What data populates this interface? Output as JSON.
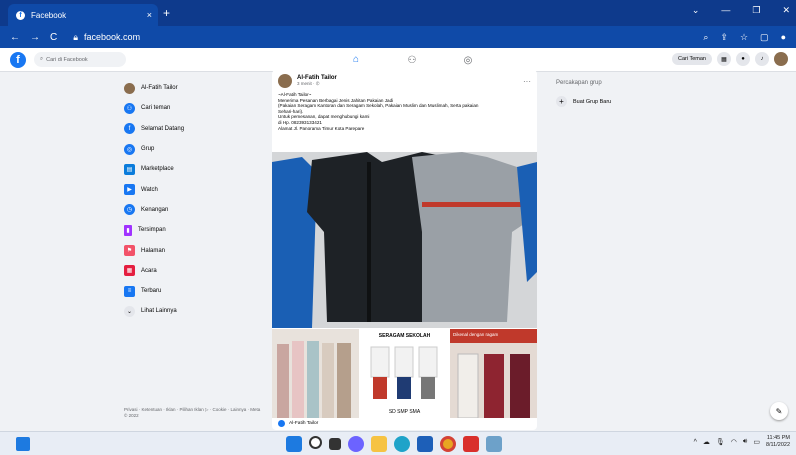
{
  "browser": {
    "tab_title": "Facebook",
    "tab_close": "×",
    "new_tab": "+",
    "url": "facebook.com",
    "min": "—",
    "max": "❐",
    "close": "✕"
  },
  "fb": {
    "search_placeholder": "Cari di Facebook",
    "find_friends_btn": "Cari Teman"
  },
  "sidebar": {
    "items": [
      {
        "label": "Al-Fatih Tailor",
        "color": "#8a6d4e"
      },
      {
        "label": "Cari teman",
        "color": "#1877f2"
      },
      {
        "label": "Selamat Datang",
        "color": "#1877f2"
      },
      {
        "label": "Grup",
        "color": "#1877f2"
      },
      {
        "label": "Marketplace",
        "color": "#0a7cdb"
      },
      {
        "label": "Watch",
        "color": "#1877f2"
      },
      {
        "label": "Kenangan",
        "color": "#1877f2"
      },
      {
        "label": "Tersimpan",
        "color": "#a033ff"
      },
      {
        "label": "Halaman",
        "color": "#f25268"
      },
      {
        "label": "Acara",
        "color": "#e41e3f"
      },
      {
        "label": "Terbaru",
        "color": "#1877f2"
      },
      {
        "label": "Lihat Lainnya",
        "color": "#e4e6eb"
      }
    ],
    "footer": "Privasi · Ketentuan · Iklan · Pilihan Iklan ▷ · Cookie · Lainnya · Meta © 2022"
  },
  "post": {
    "author": "Al-Fatih Tailor",
    "time": "3 menit · ✆",
    "menu": "···",
    "lines": [
      "~Al-Fatih Tailor~",
      "Menerima Pesanan Berbagai Jenis Jahitan Pakaian Jadi",
      "(Pakaian Seragam Kantoran dan Seragam Sekolah, Pakaian Muslim dan Muslimah, Serta pakaian",
      "Sehari-hari).",
      "Untuk pemesanan, dapat menghubungi kami",
      "di Hp. 082393133421",
      "Alamat Jl. Panorama Timur Kota Parepare"
    ],
    "img2_title": "SERAGAM SEKOLAH",
    "img2_levels": "SD  SMP  SMA",
    "img3_banner": "Dikenal dengan ragam",
    "footer_name": "Al-Fatih Tailor"
  },
  "right": {
    "header": "Percakapan grup",
    "create_group": "Buat Grup Baru"
  },
  "taskbar": {
    "time": "11:45 PM",
    "date": "8/11/2022"
  }
}
